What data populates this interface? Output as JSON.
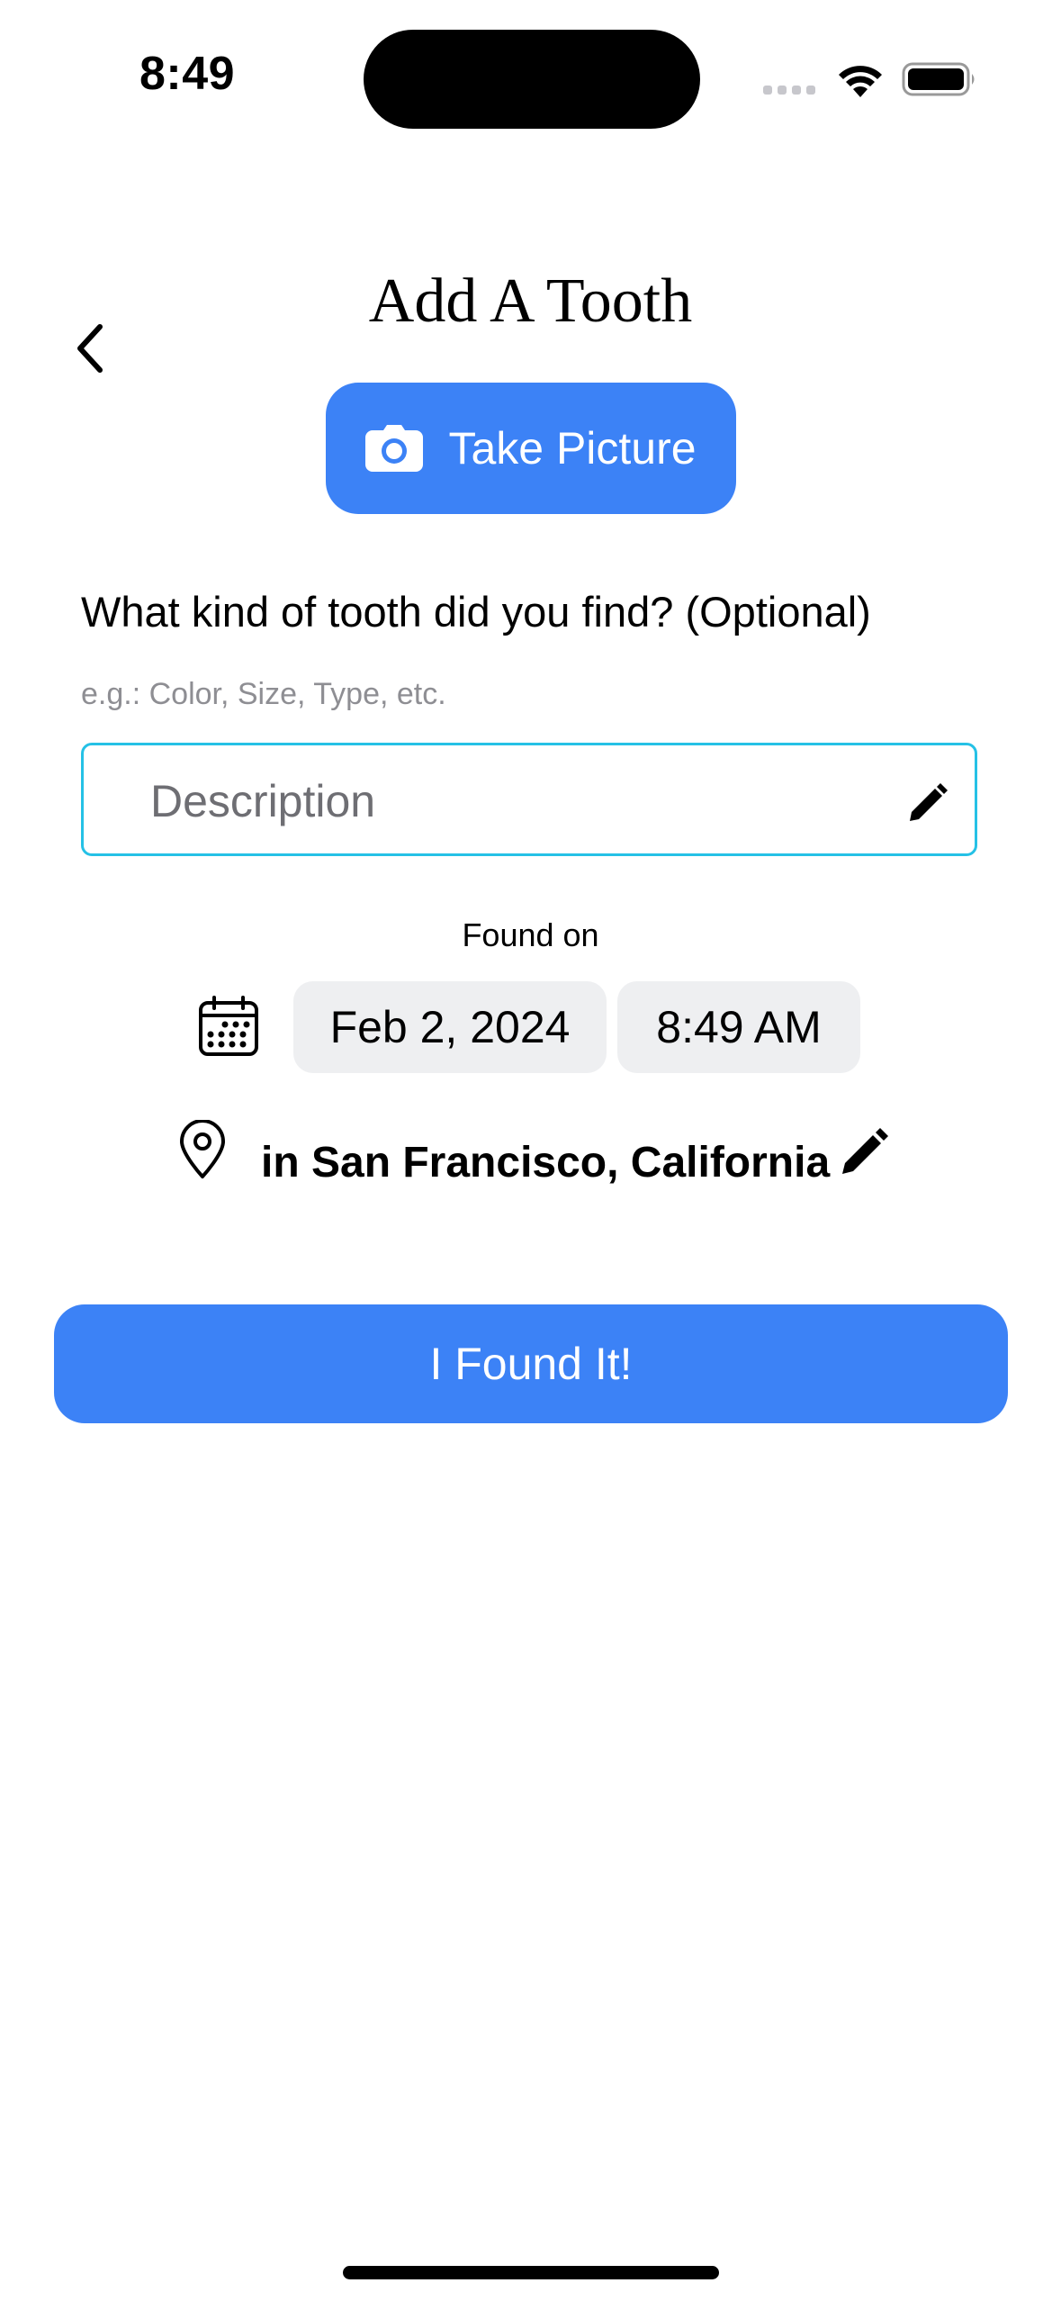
{
  "status_bar": {
    "time": "8:49"
  },
  "header": {
    "title": "Add A Tooth"
  },
  "take_picture": {
    "label": "Take Picture",
    "icon": "camera-icon"
  },
  "form": {
    "question": "What kind of tooth did you find? (Optional)",
    "hint": "e.g.: Color, Size, Type, etc.",
    "description": {
      "placeholder": "Description",
      "value": ""
    }
  },
  "found": {
    "label": "Found on",
    "date": "Feb 2, 2024",
    "time": "8:49 AM",
    "location": "in San Francisco, California"
  },
  "submit": {
    "label": "I Found It!"
  },
  "colors": {
    "accent": "#3c82f6",
    "input_border": "#25c1e6",
    "pill_bg": "#eeeff1",
    "hint": "#8e8e93"
  }
}
